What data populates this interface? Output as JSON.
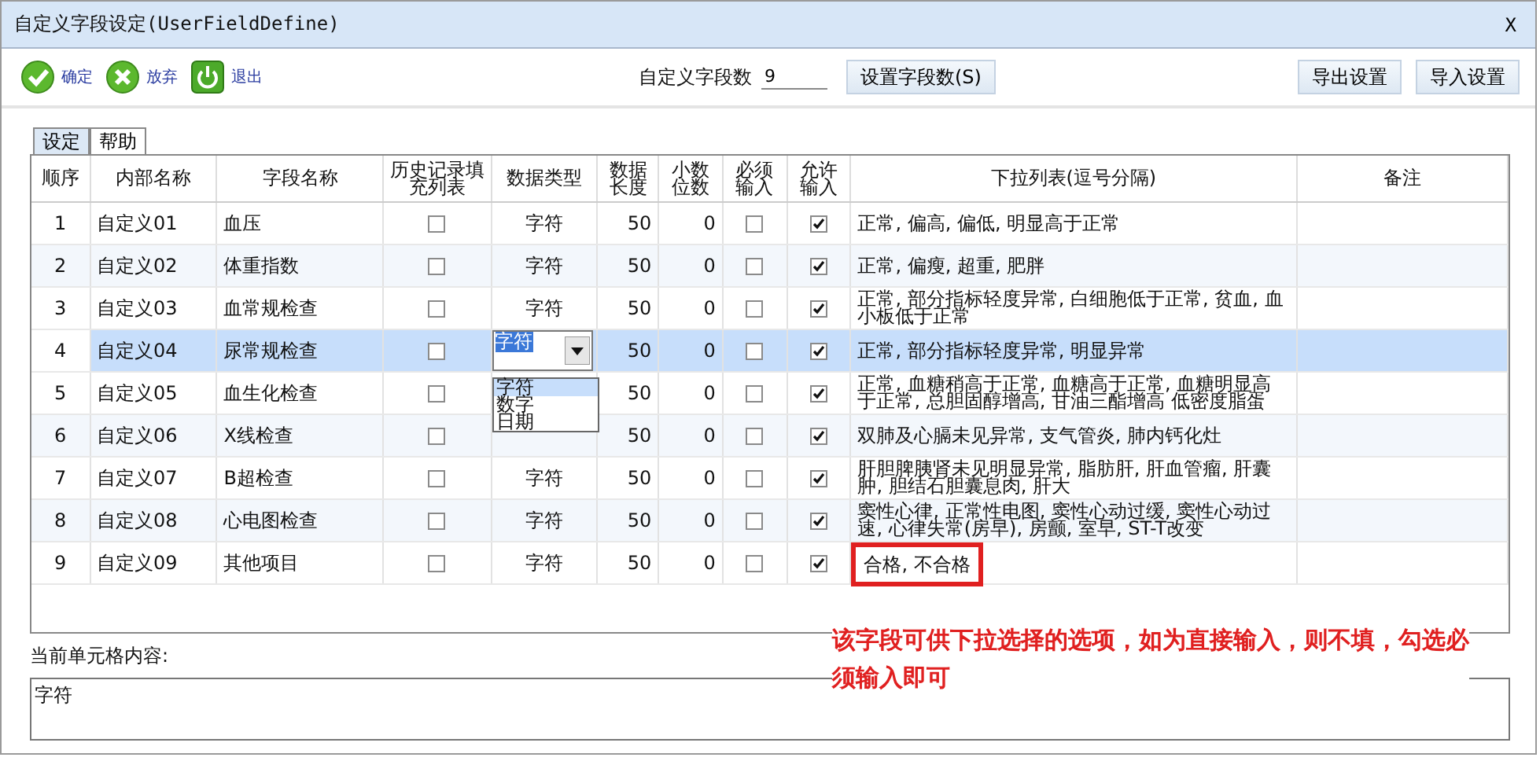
{
  "window": {
    "title": "自定义字段设定(UserFieldDefine)",
    "close": "X"
  },
  "toolbar": {
    "actions": [
      {
        "kind": "confirm",
        "label": "确定"
      },
      {
        "kind": "cancel",
        "label": "放弃"
      },
      {
        "kind": "exit",
        "label": "退出"
      }
    ],
    "field_count": {
      "label": "自定义字段数",
      "value": "9"
    },
    "set_button": "设置字段数(S)",
    "right_buttons": [
      "导出设置",
      "导入设置"
    ]
  },
  "tabs": [
    {
      "label": "设定",
      "selected": true
    },
    {
      "label": "帮助",
      "selected": false
    }
  ],
  "grid": {
    "columns": [
      "顺序",
      "内部名称",
      "字段名称",
      "历史记录填充列表",
      "数据类型",
      "数据长度",
      "小数位数",
      "必须输入",
      "允许输入",
      "下拉列表(逗号分隔)",
      "备注"
    ],
    "rows": [
      {
        "seq": "1",
        "inner": "自定义01",
        "name": "血压",
        "history": false,
        "type": "字符",
        "length": "50",
        "decimals": "0",
        "required": false,
        "allowed": true,
        "list": "正常, 偏高, 偏低, 明显高于正常",
        "selected": false,
        "highlighted": false
      },
      {
        "seq": "2",
        "inner": "自定义02",
        "name": "体重指数",
        "history": false,
        "type": "字符",
        "length": "50",
        "decimals": "0",
        "required": false,
        "allowed": true,
        "list": "正常, 偏瘦, 超重, 肥胖",
        "selected": false,
        "highlighted": false
      },
      {
        "seq": "3",
        "inner": "自定义03",
        "name": "血常规检查",
        "history": false,
        "type": "字符",
        "length": "50",
        "decimals": "0",
        "required": false,
        "allowed": true,
        "list": "正常, 部分指标轻度异常, 白细胞低于正常, 贫血, 血小板低于正常",
        "selected": false,
        "highlighted": false
      },
      {
        "seq": "4",
        "inner": "自定义04",
        "name": "尿常规检查",
        "history": false,
        "type_editor": {
          "value": "字符",
          "options": [
            {
              "label": "字符",
              "selected": true
            },
            {
              "label": "数字",
              "selected": false
            },
            {
              "label": "日期",
              "selected": false
            }
          ]
        },
        "length": "50",
        "decimals": "0",
        "required": false,
        "allowed": true,
        "list": "正常, 部分指标轻度异常, 明显异常",
        "selected": true,
        "highlighted": false
      },
      {
        "seq": "5",
        "inner": "自定义05",
        "name": "血生化检查",
        "history": false,
        "length": "50",
        "decimals": "0",
        "required": false,
        "allowed": true,
        "list": "正常, 血糖稍高于正常, 血糖高于正常, 血糖明显高于正常, 总胆固醇增高, 甘油三酯增高 低密度脂蛋",
        "selected": false,
        "highlighted": false
      },
      {
        "seq": "6",
        "inner": "自定义06",
        "name": "X线检查",
        "history": false,
        "length": "50",
        "decimals": "0",
        "required": false,
        "allowed": true,
        "list": "双肺及心膈未见异常, 支气管炎, 肺内钙化灶",
        "selected": false,
        "highlighted": false
      },
      {
        "seq": "7",
        "inner": "自定义07",
        "name": "B超检查",
        "history": false,
        "type": "字符",
        "length": "50",
        "decimals": "0",
        "required": false,
        "allowed": true,
        "list": "肝胆脾胰肾未见明显异常, 脂肪肝, 肝血管瘤, 肝囊肿, 胆结石胆囊息肉, 肝大",
        "selected": false,
        "highlighted": false
      },
      {
        "seq": "8",
        "inner": "自定义08",
        "name": "心电图检查",
        "history": false,
        "type": "字符",
        "length": "50",
        "decimals": "0",
        "required": false,
        "allowed": true,
        "list": "窦性心律, 正常性电图, 窦性心动过缓, 窦性心动过速, 心律失常(房早), 房颤, 室早, ST-T改变",
        "selected": false,
        "highlighted": false
      },
      {
        "seq": "9",
        "inner": "自定义09",
        "name": "其他项目",
        "history": false,
        "type": "字符",
        "length": "50",
        "decimals": "0",
        "required": false,
        "allowed": true,
        "list": "合格, 不合格",
        "selected": false,
        "highlighted": true
      }
    ]
  },
  "annotation": "该字段可供下拉选择的选项，如为直接输入，则不填，勾选必须输入即可",
  "current_cell": {
    "label": "当前单元格内容:",
    "value": "字符"
  }
}
